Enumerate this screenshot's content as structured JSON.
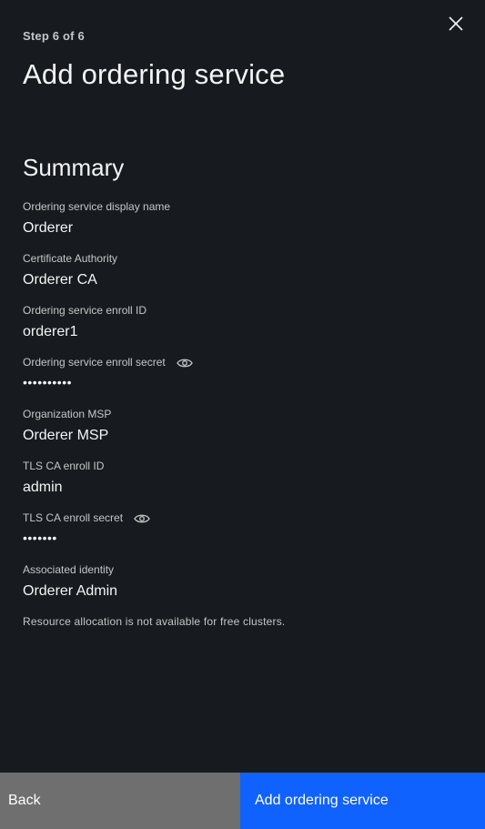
{
  "header": {
    "step": "Step 6 of 6",
    "title": "Add ordering service"
  },
  "summary": {
    "title": "Summary",
    "fields": [
      {
        "label": "Ordering service display name",
        "value": "Orderer"
      },
      {
        "label": "Certificate Authority",
        "value": "Orderer CA"
      },
      {
        "label": "Ordering service enroll ID",
        "value": "orderer1"
      },
      {
        "label": "Ordering service enroll secret",
        "value": "••••••••••",
        "icon": "eye-icon"
      },
      {
        "label": "Organization MSP",
        "value": "Orderer MSP"
      },
      {
        "label": "TLS CA enroll ID",
        "value": "admin"
      },
      {
        "label": "TLS CA enroll secret",
        "value": "•••••••",
        "icon": "eye-icon"
      },
      {
        "label": "Associated identity",
        "value": "Orderer Admin"
      }
    ],
    "note": "Resource allocation is not available for free clusters."
  },
  "footer": {
    "back_label": "Back",
    "submit_label": "Add ordering service"
  },
  "colors": {
    "background": "#171b1f",
    "primary": "#0f62fe",
    "secondary": "#6f6f6f"
  }
}
